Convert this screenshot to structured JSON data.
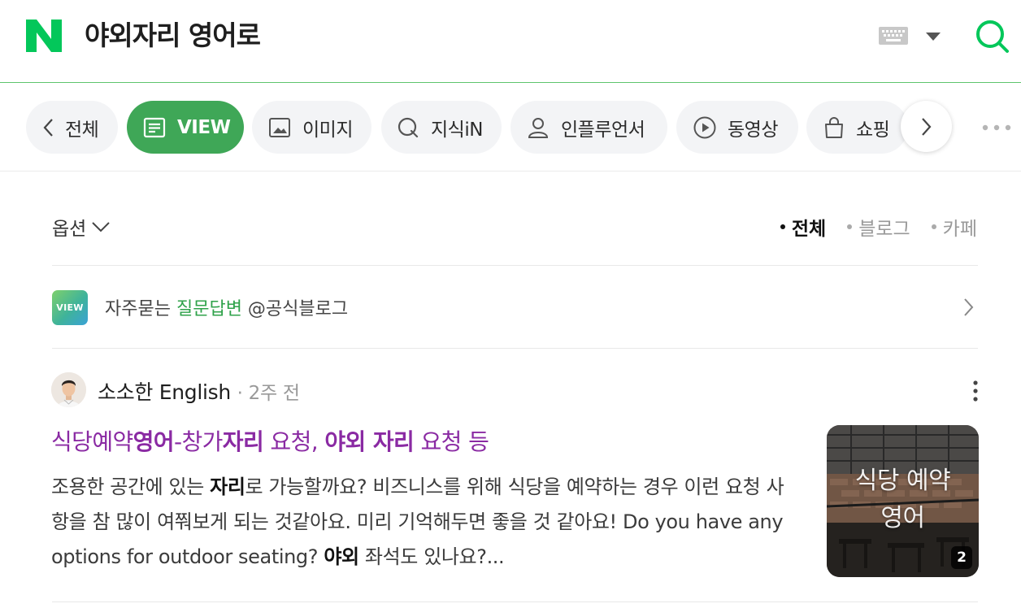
{
  "header": {
    "query": "야외자리 영어로",
    "icons": [
      "naver-logo",
      "keyboard-icon",
      "dropdown-caret-icon",
      "search-icon"
    ],
    "accent_color": "#03c75a"
  },
  "tabs": [
    {
      "label": "전체",
      "icon": "chevron-left-icon",
      "active": false
    },
    {
      "label": "VIEW",
      "icon": "document-icon",
      "active": true
    },
    {
      "label": "이미지",
      "icon": "image-icon",
      "active": false
    },
    {
      "label": "지식iN",
      "icon": "q-icon",
      "active": false
    },
    {
      "label": "인플루언서",
      "icon": "person-icon",
      "active": false
    },
    {
      "label": "동영상",
      "icon": "play-icon",
      "active": false
    },
    {
      "label": "쇼핑",
      "icon": "bag-icon",
      "active": false
    }
  ],
  "options": {
    "label": "옵션",
    "filters": [
      {
        "label": "전체",
        "active": true
      },
      {
        "label": "블로그",
        "active": false
      },
      {
        "label": "카페",
        "active": false
      }
    ]
  },
  "faq": {
    "badge": "VIEW",
    "prefix": "자주묻는 ",
    "highlight": "질문답변",
    "suffix": " @공식블로그"
  },
  "post": {
    "author": "소소한 English",
    "time": "2주 전",
    "title_parts": [
      {
        "text": "식당예약",
        "bold": false
      },
      {
        "text": "영어",
        "bold": true
      },
      {
        "text": "-창가",
        "bold": false
      },
      {
        "text": "자리",
        "bold": true
      },
      {
        "text": " 요청, ",
        "bold": false
      },
      {
        "text": "야외 자리",
        "bold": true
      },
      {
        "text": " 요청 등",
        "bold": false
      }
    ],
    "snippet_parts": [
      {
        "text": "조용한 공간에 있는 ",
        "bold": false
      },
      {
        "text": "자리",
        "bold": true
      },
      {
        "text": "로 가능할까요? 비즈니스를 위해 식당을 예약하는 경우 이런 요청 사항을 참 많이 여쭤보게 되는 것같아요. 미리 기억해두면 좋을 것 같아요! Do you have any options for outdoor seating? ",
        "bold": false
      },
      {
        "text": "야외",
        "bold": true
      },
      {
        "text": " 좌석도 있나요?...",
        "bold": false
      }
    ],
    "thumbnail_text_line1": "식당 예약",
    "thumbnail_text_line2": "영어",
    "image_count": "2"
  }
}
